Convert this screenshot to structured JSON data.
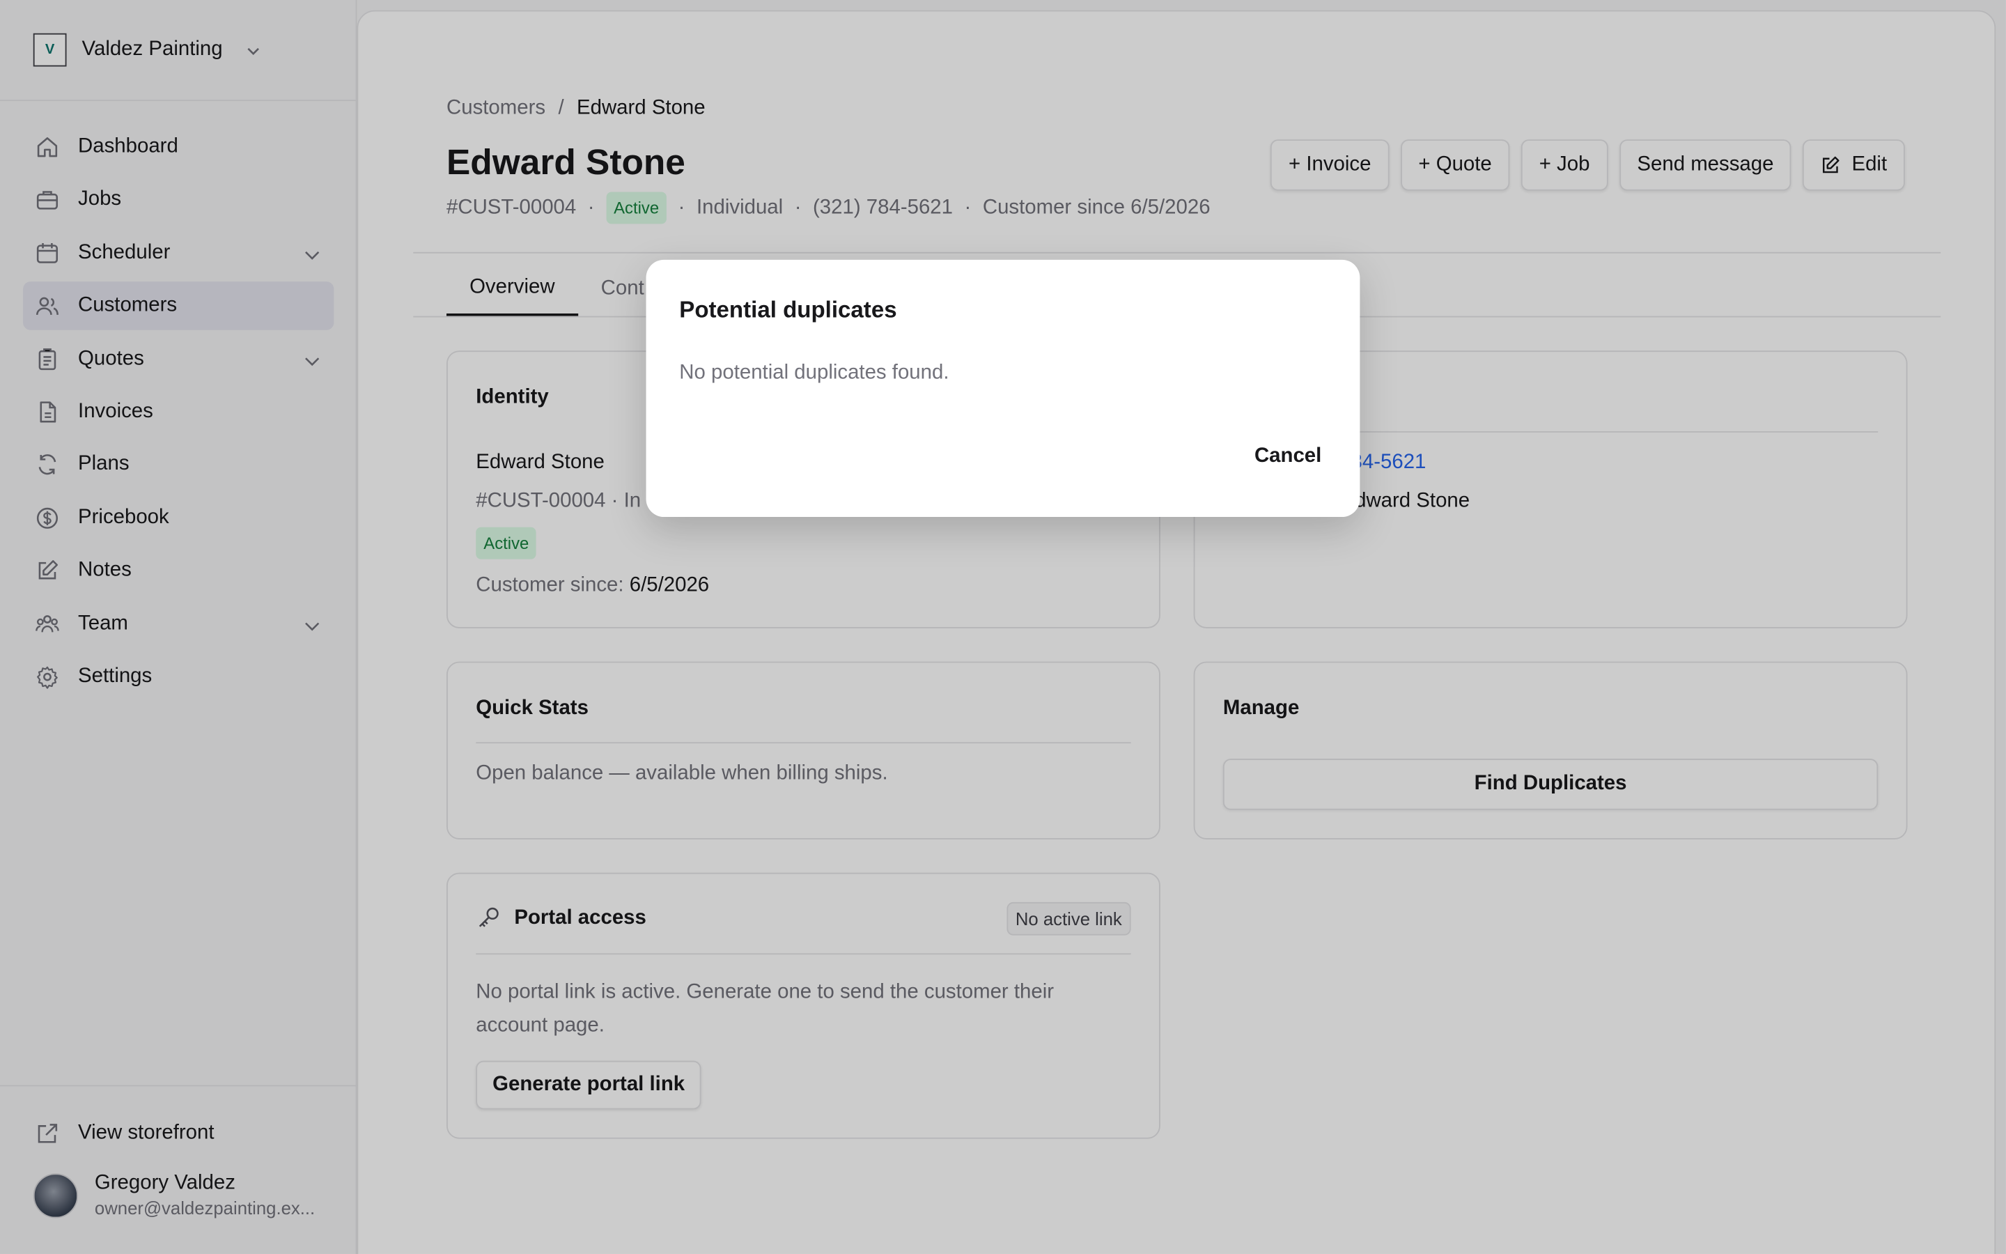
{
  "sidebar": {
    "brand": {
      "logo_text": "V",
      "name": "Valdez Painting"
    },
    "items": [
      {
        "label": "Dashboard",
        "icon": "home-icon"
      },
      {
        "label": "Jobs",
        "icon": "briefcase-icon"
      },
      {
        "label": "Scheduler",
        "icon": "calendar-icon",
        "expandable": true
      },
      {
        "label": "Customers",
        "icon": "users-icon",
        "active": true
      },
      {
        "label": "Quotes",
        "icon": "clipboard-icon",
        "expandable": true
      },
      {
        "label": "Invoices",
        "icon": "file-icon"
      },
      {
        "label": "Plans",
        "icon": "refresh-icon"
      },
      {
        "label": "Pricebook",
        "icon": "dollar-icon"
      },
      {
        "label": "Notes",
        "icon": "pencil-icon"
      },
      {
        "label": "Team",
        "icon": "team-icon",
        "expandable": true
      },
      {
        "label": "Settings",
        "icon": "gear-icon"
      }
    ],
    "storefront_label": "View storefront",
    "user": {
      "name": "Gregory Valdez",
      "email": "owner@valdezpainting.ex..."
    }
  },
  "breadcrumb": {
    "parent": "Customers",
    "separator": "/",
    "current": "Edward Stone"
  },
  "customer": {
    "name": "Edward Stone",
    "id": "#CUST-00004",
    "status": "Active",
    "type": "Individual",
    "phone": "(321) 784-5621",
    "since_text": "Customer since 6/5/2026",
    "dot": "·"
  },
  "actions": {
    "invoice": "+ Invoice",
    "quote": "+ Quote",
    "job": "+ Job",
    "send_message": "Send message",
    "edit": "Edit"
  },
  "tabs": [
    "Overview",
    "Cont"
  ],
  "identity_card": {
    "title": "Identity",
    "name": "Edward Stone",
    "id_line": "#CUST-00004 · In",
    "status": "Active",
    "since_label": "Customer since:",
    "since_value": "6/5/2026"
  },
  "contact_card": {
    "phone_partial": "34-5621",
    "contact_label_partial": "t:",
    "contact_value": "Edward Stone"
  },
  "quick_stats": {
    "title": "Quick Stats",
    "text": "Open balance — available when billing ships."
  },
  "manage": {
    "title": "Manage",
    "button": "Find Duplicates"
  },
  "portal": {
    "title": "Portal access",
    "badge": "No active link",
    "text_line1": "No portal link is active. Generate one to send the customer their",
    "text_line2": "account page.",
    "button": "Generate portal link"
  },
  "modal": {
    "title": "Potential duplicates",
    "body": "No potential duplicates found.",
    "cancel": "Cancel"
  },
  "colors": {
    "accent_link": "#2563eb",
    "active_badge_bg": "#dcfce7",
    "active_badge_text": "#15803d"
  }
}
